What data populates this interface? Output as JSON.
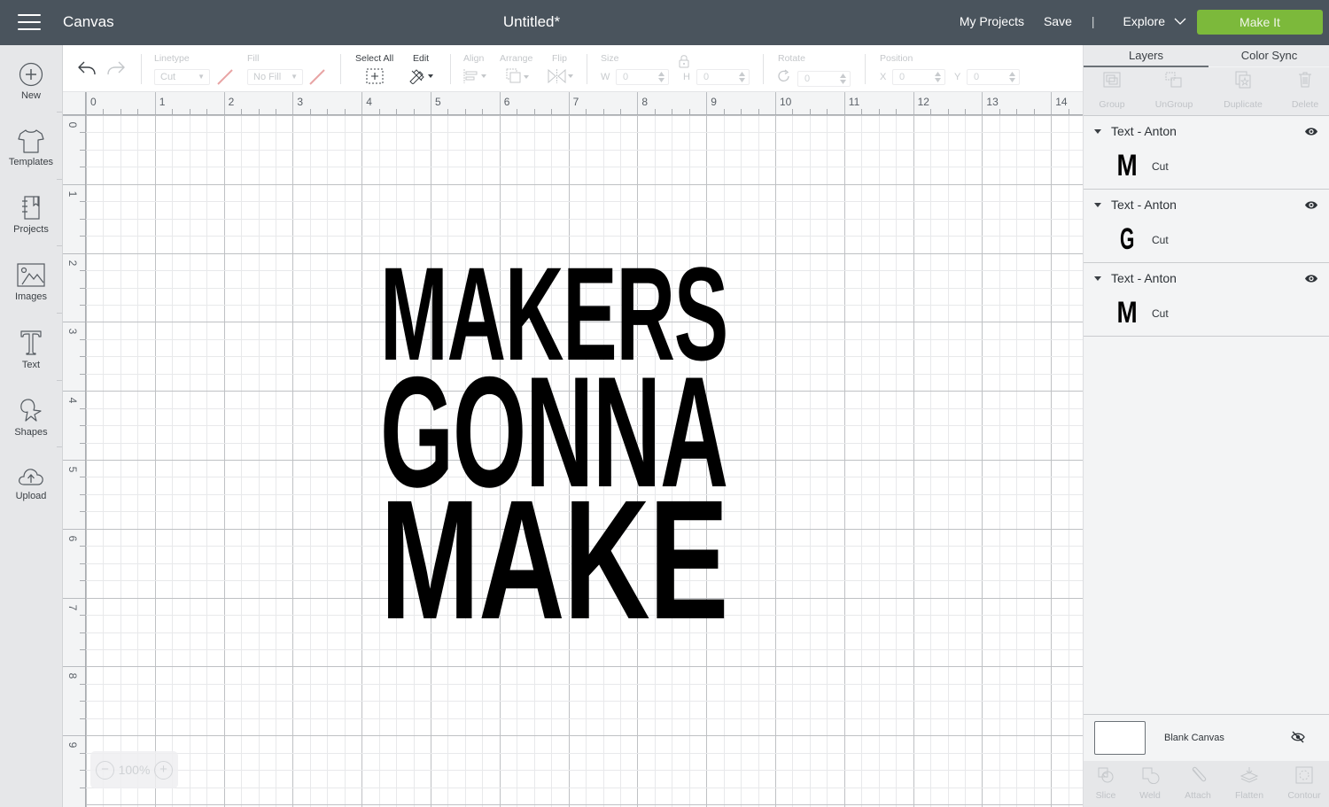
{
  "topbar": {
    "app_name": "Canvas",
    "doc_title": "Untitled*",
    "links": {
      "my_projects": "My Projects",
      "save": "Save",
      "separator": "|",
      "explore": "Explore"
    },
    "make_it": "Make It",
    "make_it_color": "#7cb93b"
  },
  "sidebar": {
    "items": [
      {
        "label": "New",
        "icon": "plus-circle-icon"
      },
      {
        "label": "Templates",
        "icon": "tshirt-icon"
      },
      {
        "label": "Projects",
        "icon": "notebook-icon"
      },
      {
        "label": "Images",
        "icon": "image-icon"
      },
      {
        "label": "Text",
        "icon": "text-icon"
      },
      {
        "label": "Shapes",
        "icon": "shapes-icon"
      },
      {
        "label": "Upload",
        "icon": "cloud-upload-icon"
      }
    ]
  },
  "toolbar": {
    "linetype": {
      "label": "Linetype",
      "value": "Cut"
    },
    "fill": {
      "label": "Fill",
      "value": "No Fill"
    },
    "select_all": "Select All",
    "edit": "Edit",
    "align": "Align",
    "arrange": "Arrange",
    "flip": "Flip",
    "size": {
      "label": "Size",
      "w_label": "W",
      "w_value": "0",
      "h_label": "H",
      "h_value": "0"
    },
    "rotate": {
      "label": "Rotate",
      "value": "0"
    },
    "position": {
      "label": "Position",
      "x_label": "X",
      "x_value": "0",
      "y_label": "Y",
      "y_value": "0"
    }
  },
  "rulers": {
    "horizontal": [
      "0",
      "1",
      "2",
      "3",
      "4",
      "5",
      "6",
      "7",
      "8",
      "9",
      "10",
      "11",
      "12",
      "13",
      "14"
    ],
    "vertical": [
      "0",
      "1",
      "2",
      "3",
      "4",
      "5",
      "6",
      "7",
      "8",
      "9"
    ]
  },
  "canvas": {
    "design_lines": [
      "MAKERS",
      "GONNA",
      "MAKE"
    ],
    "zoom": "100%"
  },
  "panel": {
    "tabs": [
      "Layers",
      "Color Sync"
    ],
    "active_tab": "Layers",
    "actions": [
      "Group",
      "UnGroup",
      "Duplicate",
      "Delete"
    ],
    "layers": [
      {
        "title": "Text - Anton",
        "thumb": "M",
        "type": "Cut",
        "visible": true
      },
      {
        "title": "Text - Anton",
        "thumb": "G",
        "type": "Cut",
        "visible": true
      },
      {
        "title": "Text - Anton",
        "thumb": "M",
        "type": "Cut",
        "visible": true
      }
    ],
    "blank_canvas": "Blank Canvas",
    "bottom_actions": [
      "Slice",
      "Weld",
      "Attach",
      "Flatten",
      "Contour"
    ]
  }
}
